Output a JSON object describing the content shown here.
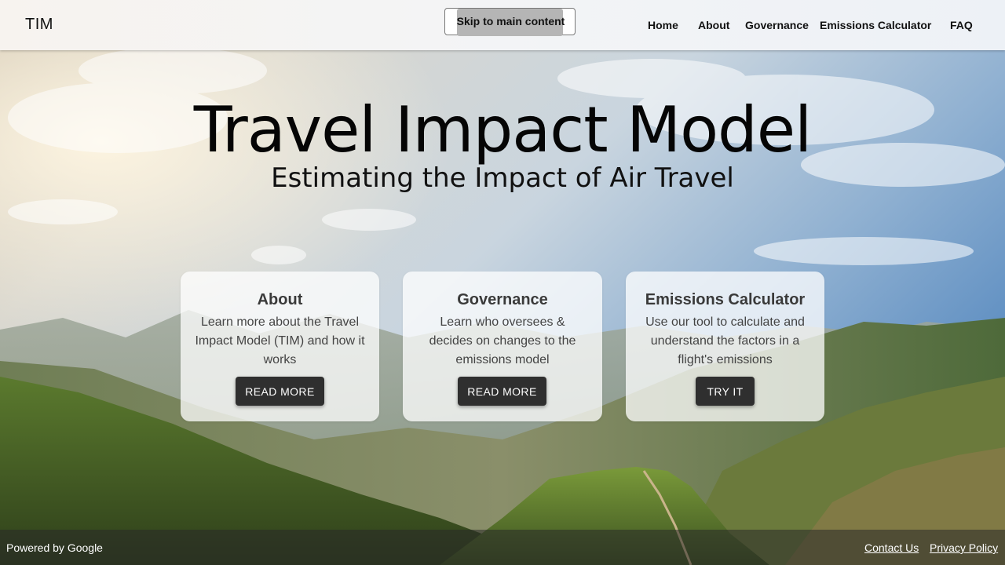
{
  "header": {
    "logo": "TIM",
    "skip_link": "Skip to main content",
    "nav": [
      "Home",
      "About",
      "Governance",
      "Emissions Calculator",
      "FAQ"
    ]
  },
  "hero": {
    "title": "Travel Impact Model",
    "subtitle": "Estimating the Impact of Air Travel"
  },
  "cards": [
    {
      "title": "About",
      "description": "Learn more about the Travel Impact Model (TIM) and how it works",
      "button": "READ MORE"
    },
    {
      "title": "Governance",
      "description": "Learn who oversees & decides on changes to the emissions model",
      "button": "READ MORE"
    },
    {
      "title": "Emissions Calculator",
      "description": "Use our tool to calculate and understand the factors in a flight's emissions",
      "button": "TRY IT"
    }
  ],
  "footer": {
    "powered_by": "Powered by Google",
    "links": [
      "Contact Us",
      "Privacy Policy"
    ]
  },
  "colors": {
    "card_background": "#ffffffbf",
    "button_background": "#2f2f2f",
    "footer_background": "#282828"
  }
}
